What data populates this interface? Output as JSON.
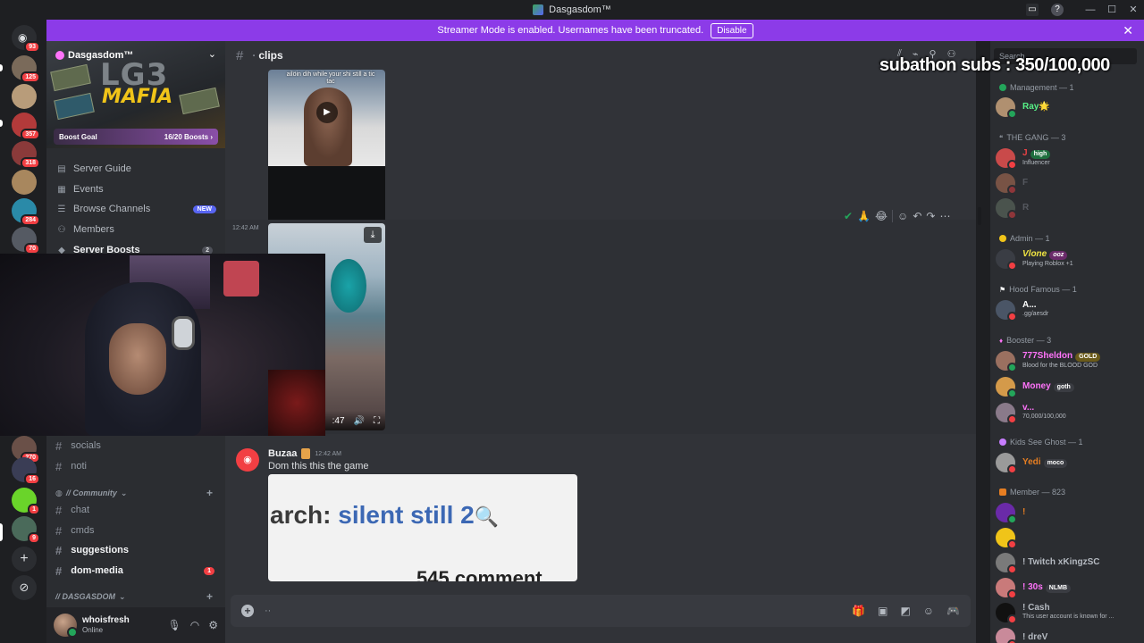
{
  "window": {
    "title": "Dasgasdom™"
  },
  "streamer_bar": {
    "message": "Streamer Mode is enabled. Usernames have been truncated.",
    "disable_label": "Disable"
  },
  "overlay": {
    "subathon": "subathon subs : 350/100,000"
  },
  "servers": {
    "badges": [
      "93",
      "125",
      "357",
      "318",
      "284",
      "70",
      "270",
      "16",
      "1",
      "9"
    ]
  },
  "server": {
    "name": "Dasgasdom™",
    "banner_line1": "LG3",
    "banner_line2": "MAFIA",
    "boost_goal_label": "Boost Goal",
    "boost_goal_value": "16/20 Boosts",
    "nav": [
      {
        "label": "Server Guide",
        "icon": "book-icon"
      },
      {
        "label": "Events",
        "icon": "calendar-icon"
      },
      {
        "label": "Browse Channels",
        "icon": "browse-icon",
        "badge": "NEW"
      },
      {
        "label": "Members",
        "icon": "members-icon"
      },
      {
        "label": "Server Boosts",
        "icon": "boost-icon",
        "count": "2"
      }
    ],
    "channels_top": [
      "socials",
      "noti"
    ],
    "category_community": "// Community",
    "channels_community": [
      {
        "name": "chat",
        "unread": false
      },
      {
        "name": "cmds",
        "unread": false
      },
      {
        "name": "suggestions",
        "unread": true
      },
      {
        "name": "dom-media",
        "unread": true,
        "mentions": "1"
      }
    ],
    "category_dasgasdom": "// DASGASDOM"
  },
  "user": {
    "name": "whoisfresh",
    "status": "Online"
  },
  "channel": {
    "name": "clips",
    "composer_placeholder": "··"
  },
  "messages": {
    "video1_caption": "ailöin dih while your shi still a tic tac",
    "timestamp_2": "12:42 AM",
    "video2_time": ":47",
    "buzaa_name": "Buzaa",
    "buzaa_time": "12:42 AM",
    "buzaa_text": "Dom this this the game",
    "embed_prefix": "arch: ",
    "embed_query": "silent still 2",
    "embed_comments": "545 comment"
  },
  "members": {
    "search_placeholder": "Search",
    "groups": [
      {
        "role": "Management — 1",
        "color": "#23a55a"
      },
      {
        "role": "THE GANG — 3",
        "color": "#949ba4"
      },
      {
        "role": "Admin — 1",
        "color": "#f0c419"
      },
      {
        "role": "Hood Famous — 1",
        "color": "#ffffff"
      },
      {
        "role": "Booster — 3",
        "color": "#ff73fa"
      },
      {
        "role": "Kids See Ghost — 1",
        "color": "#c77dff"
      },
      {
        "role": "Member — 823",
        "color": "#e67e22"
      }
    ],
    "list": [
      {
        "name": "Ray🌟",
        "color": "#57f287",
        "sub": "",
        "pill": ""
      },
      {
        "name": "J",
        "color": "#ed4245",
        "sub": "Influencer",
        "pill": "high"
      },
      {
        "name": "F",
        "color": "#5c5f66",
        "sub": "",
        "pill": ""
      },
      {
        "name": "R",
        "color": "#5c5f66",
        "sub": "",
        "pill": ""
      },
      {
        "name": "Vlone",
        "color": "#f0e442",
        "sub": "Playing Roblox +1",
        "pill": "ooz"
      },
      {
        "name": "A...",
        "color": "#ffffff",
        "sub": ".gg/aesdr",
        "pill": ""
      },
      {
        "name": "777Sheldon",
        "color": "#ff73fa",
        "sub": "Blood for the BLOOD GOD",
        "pill": "GOLD"
      },
      {
        "name": "Money",
        "color": "#ff73fa",
        "sub": "",
        "pill": "goth"
      },
      {
        "name": "v...",
        "color": "#ff73fa",
        "sub": "70,000/100,000",
        "pill": ""
      },
      {
        "name": "Yedi",
        "color": "#e67e22",
        "sub": "",
        "pill": "moco"
      },
      {
        "name": "!",
        "color": "#e67e22",
        "sub": "",
        "pill": ""
      },
      {
        "name": "",
        "color": "#e67e22",
        "sub": "",
        "pill": ""
      },
      {
        "name": "! Twitch xKingzSC",
        "color": "#b5bac1",
        "sub": "",
        "pill": ""
      },
      {
        "name": "! 30s",
        "color": "#ff73fa",
        "sub": "",
        "pill": "NLMB"
      },
      {
        "name": "! Cash",
        "color": "#b5bac1",
        "sub": "This user account is known for ...",
        "pill": ""
      },
      {
        "name": "! dreV",
        "color": "#b5bac1",
        "sub": "",
        "pill": ""
      }
    ]
  }
}
